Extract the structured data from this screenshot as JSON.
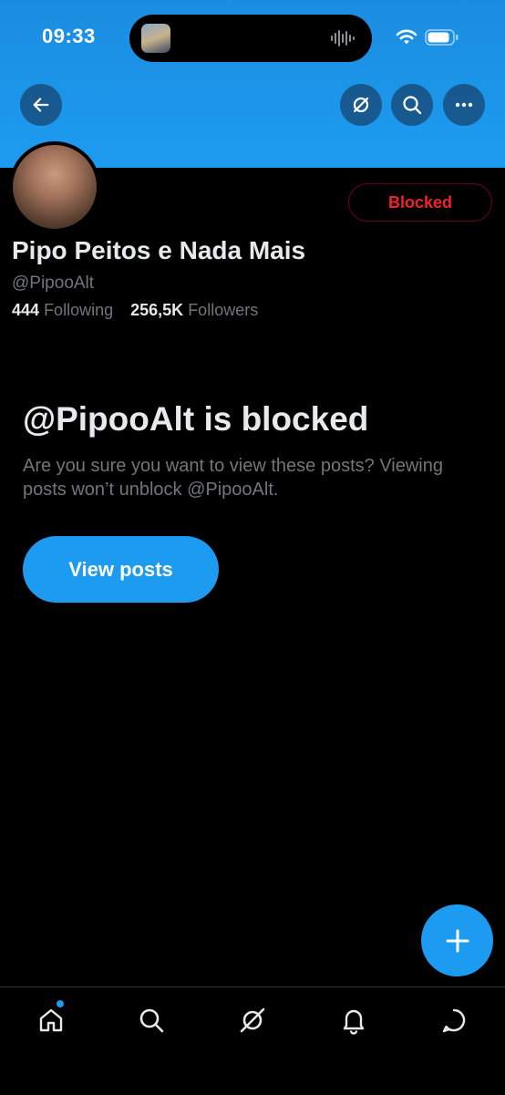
{
  "status_bar": {
    "time": "09:33"
  },
  "profile": {
    "name": "Pipo Peitos e Nada Mais",
    "handle": "@PipooAlt",
    "following_count": "444",
    "following_label": "Following",
    "followers_count": "256,5K",
    "followers_label": "Followers",
    "blocked_button_label": "Blocked"
  },
  "blocked_notice": {
    "title": "@PipooAlt is blocked",
    "message": "Are you sure you want to view these posts? Viewing posts won’t unblock @PipooAlt.",
    "view_button_label": "View posts"
  },
  "icons": {
    "back": "arrow-left-icon",
    "grok": "grok-icon",
    "search": "search-icon",
    "more": "more-icon",
    "compose": "plus-icon",
    "tabs": [
      "home-icon",
      "search-icon",
      "grok-icon",
      "bell-icon",
      "message-icon"
    ]
  },
  "colors": {
    "accent": "#1d9bf0",
    "blocked_red": "#f4212e",
    "background": "#000000",
    "secondary_text": "#71767b"
  }
}
